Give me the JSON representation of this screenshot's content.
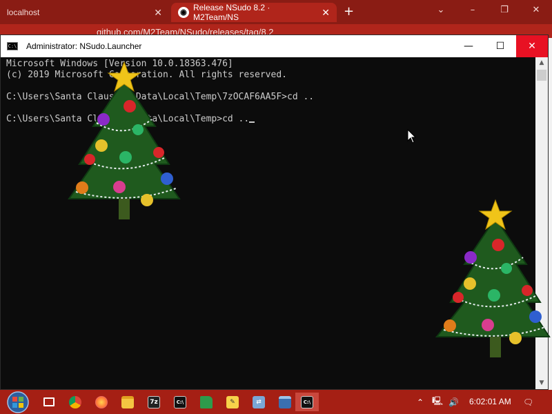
{
  "browser": {
    "tabs": [
      {
        "label": "localhost"
      },
      {
        "label": "Release NSudo 8.2 · M2Team/NS"
      }
    ],
    "url": "github.com/M2Team/NSudo/releases/tag/8.2"
  },
  "console": {
    "title": "Administrator: NSudo.Launcher",
    "lines": [
      "Microsoft Windows [Version 10.0.18363.476]",
      "(c) 2019 Microsoft Corporation. All rights reserved.",
      "",
      "C:\\Users\\Santa Claus\\AppData\\Local\\Temp\\7zOCAF6AA5F>cd ..",
      "",
      "C:\\Users\\Santa Claus\\AppData\\Local\\Temp>cd .."
    ]
  },
  "taskbar": {
    "apps": [
      {
        "name": "task-view-icon"
      },
      {
        "name": "chrome-icon",
        "color": "#db4437"
      },
      {
        "name": "firefox-icon",
        "color": "#ff7139"
      },
      {
        "name": "file-explorer-icon",
        "color": "#f4c542"
      },
      {
        "name": "7zip-icon",
        "label": "7z",
        "color": "#222222"
      },
      {
        "name": "console-icon",
        "label": "C:\\",
        "color": "#111111"
      },
      {
        "name": "notepad-plus-icon",
        "color": "#2e9b4b"
      },
      {
        "name": "notes-icon",
        "color": "#f7d24a"
      },
      {
        "name": "network-tool-icon",
        "color": "#7aa7d6"
      },
      {
        "name": "app-window-icon",
        "color": "#3a6fb0"
      },
      {
        "name": "console-active-icon",
        "label": "C:\\",
        "color": "#111111"
      }
    ],
    "clock": "6:02:01 AM"
  },
  "colors": {
    "accent": "#a51f14",
    "console_bg": "#0c0c0c",
    "console_text": "#cccccc",
    "close_red": "#e81123"
  }
}
